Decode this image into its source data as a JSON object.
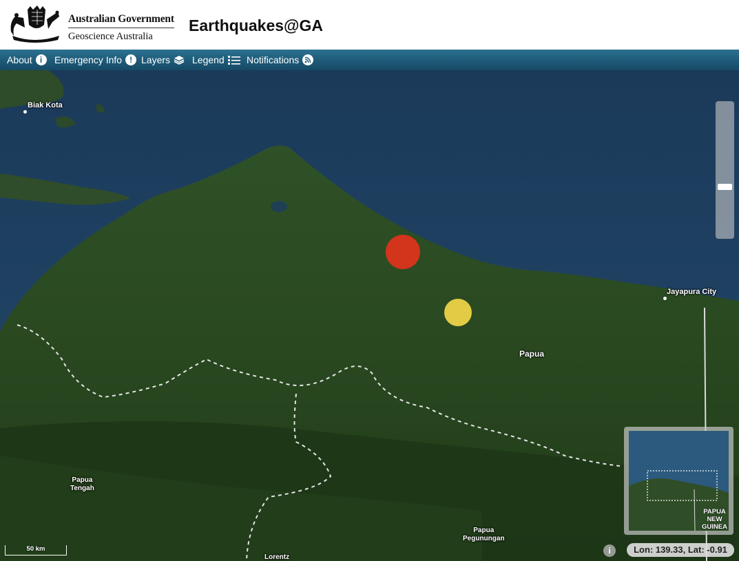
{
  "header": {
    "gov_line1": "Australian Government",
    "gov_line2": "Geoscience Australia",
    "app_title": "Earthquakes@GA"
  },
  "nav": {
    "about": "About",
    "emergency": "Emergency Info",
    "layers": "Layers",
    "legend": "Legend",
    "notifications": "Notifications"
  },
  "map": {
    "places": {
      "biak_kota": "Biak Kota",
      "jayapura": "Jayapura City",
      "papua": "Papua",
      "papua_tengah": "Papua\nTengah",
      "papua_pegunungan": "Papua\nPegunungan",
      "lorentz": "Lorentz"
    },
    "quake_colors": {
      "large": "#d3341c",
      "small": "#e2cc45"
    },
    "overview_label": "PAPUA\nNEW\nGUINEA",
    "scale": "50 km",
    "info_icon": "i",
    "coords": "Lon: 139.33, Lat: -0.91"
  },
  "colors": {
    "nav_bg": "#1e5a78",
    "sea": "#1f4466",
    "land": "#2a4a22"
  }
}
